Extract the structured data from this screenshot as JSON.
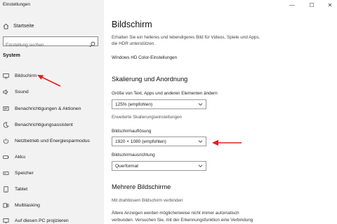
{
  "window": {
    "title": "Einstellungen",
    "min_label": "—",
    "max_label": "☐",
    "close_label": "✕"
  },
  "sidebar": {
    "home_label": "Startseite",
    "search_placeholder": "Einstellung suchen",
    "section_title": "System",
    "items": [
      {
        "label": "Bildschirm",
        "icon": "monitor-icon"
      },
      {
        "label": "Sound",
        "icon": "speaker-icon"
      },
      {
        "label": "Benachrichtigungen & Aktionen",
        "icon": "notification-icon"
      },
      {
        "label": "Benachrichtigungsassistent",
        "icon": "moon-icon"
      },
      {
        "label": "Netzbetrieb und Energiesparmodus",
        "icon": "power-icon"
      },
      {
        "label": "Akku",
        "icon": "battery-icon"
      },
      {
        "label": "Speicher",
        "icon": "storage-icon"
      },
      {
        "label": "Tablet",
        "icon": "tablet-icon"
      },
      {
        "label": "Multitasking",
        "icon": "multitasking-icon"
      },
      {
        "label": "Auf diesen PC projizieren",
        "icon": "project-icon"
      }
    ]
  },
  "main": {
    "title": "Bildschirm",
    "description": "Erhalten Sie ein helleres und lebendigeres Bild für Videos, Spiele und Apps, die HDR unterstützen.",
    "hd_link": "Windows HD Color-Einstellungen",
    "scale_section": "Skalierung und Anordnung",
    "scale_label": "Größe von Text, Apps und anderen Elementen ändern",
    "scale_value": "125% (empfohlen)",
    "advanced_scale_link": "Erweiterte Skalierungseinstellungen",
    "resolution_label": "Bildschirmauflösung",
    "resolution_value": "1920 × 1080 (empfohlen)",
    "orientation_label": "Bildschirmausrichtung",
    "orientation_value": "Querformat",
    "multi_section": "Mehrere Bildschirme",
    "wireless_link": "Mit drahtlosem Bildschirm verbinden",
    "older_line1": "Ältere Anzeigen werden möglicherweise nicht immer automatisch",
    "older_line2": "verbunden. Versuchen Sie, mit der Erkennungsfunktion eine Verbindung"
  },
  "annotation_color": "#e0201a"
}
